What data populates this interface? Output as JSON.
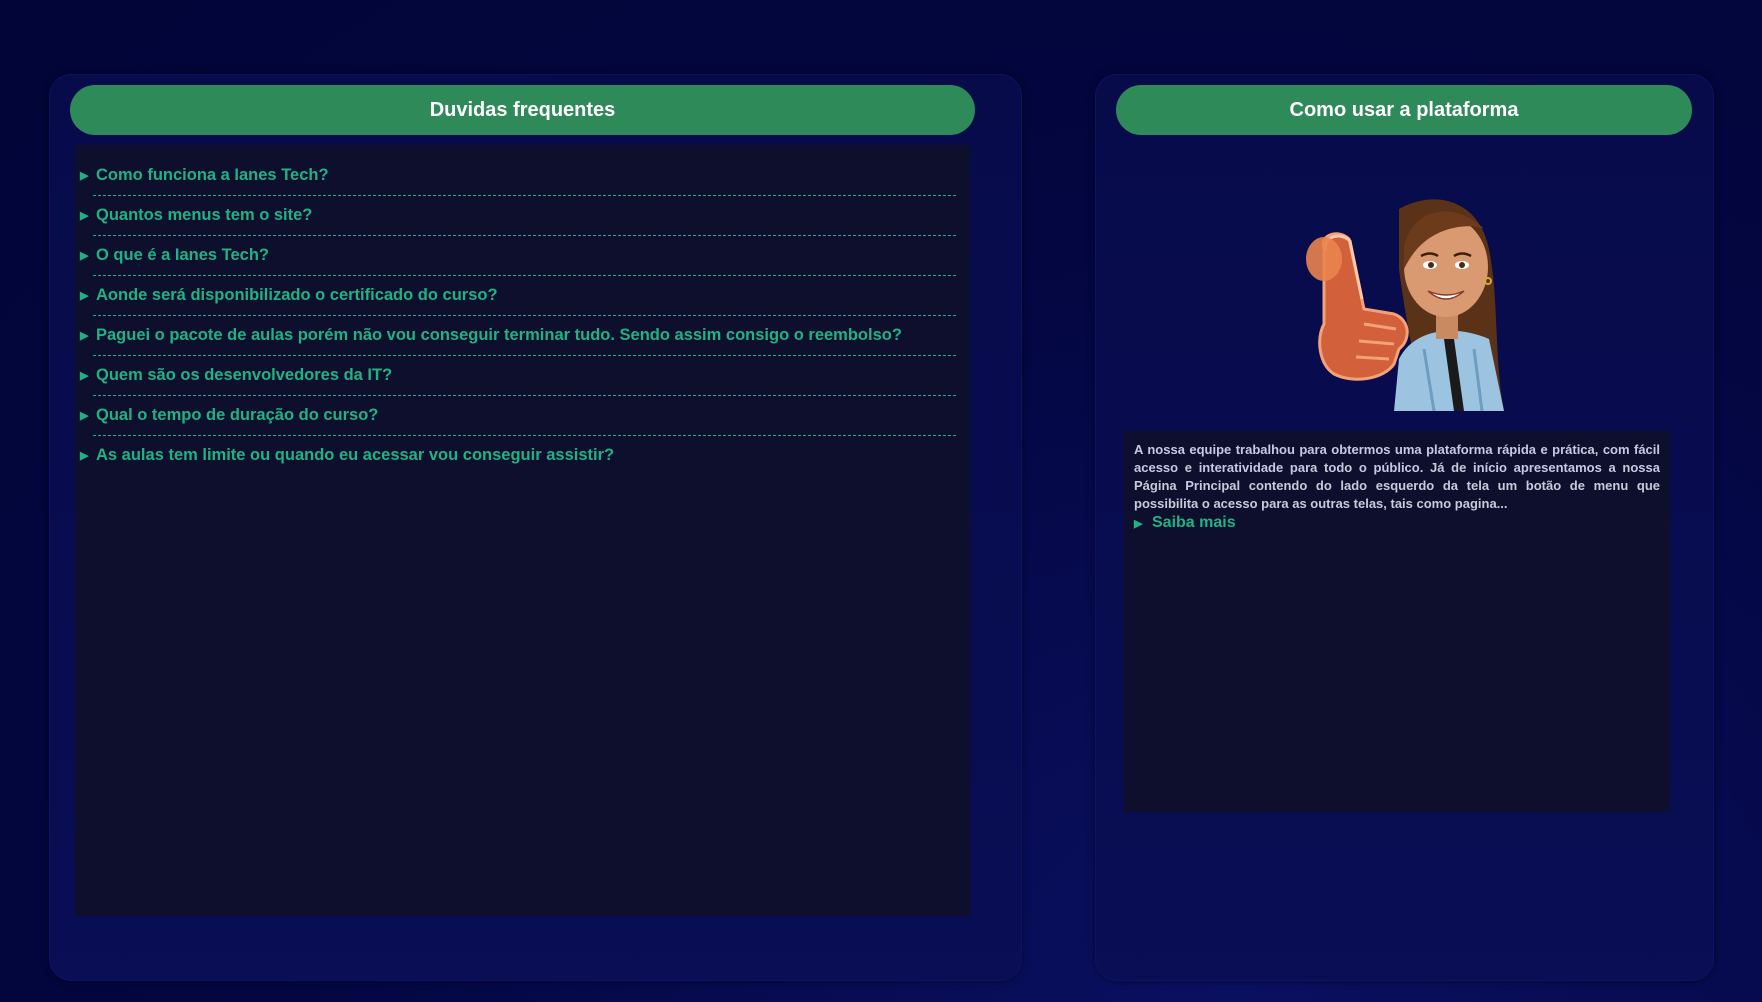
{
  "faq": {
    "title": "Duvidas frequentes",
    "items": [
      {
        "question": "Como funciona a Ianes Tech?"
      },
      {
        "question": "Quantos menus tem o site?"
      },
      {
        "question": "O que é a Ianes Tech?"
      },
      {
        "question": "Aonde será disponibilizado o certificado do curso?"
      },
      {
        "question": "Paguei o pacote de aulas porém não vou conseguir terminar tudo. Sendo assim consigo o reembolso?"
      },
      {
        "question": "Quem são os desenvolvedores da IT?"
      },
      {
        "question": "Qual o tempo de duração do curso?"
      },
      {
        "question": "As aulas tem limite ou quando eu acessar vou conseguir assistir?"
      }
    ],
    "marker": "▶"
  },
  "howto": {
    "title": "Como usar a plataforma",
    "description": "A nossa equipe trabalhou para obtermos uma plataforma rápida e prática, com fácil acesso e interatividade para todo o público. Já de início apresentamos a nossa Página Principal contendo do lado esquerdo da tela um botão de menu que possibilita o acesso para as outras telas, tais como pagina...",
    "more_label": "Saiba mais",
    "marker": "▶"
  },
  "colors": {
    "accent": "#2e8a58",
    "link": "#1fb384",
    "background": "#02053a",
    "box": "#0e0f2c"
  }
}
